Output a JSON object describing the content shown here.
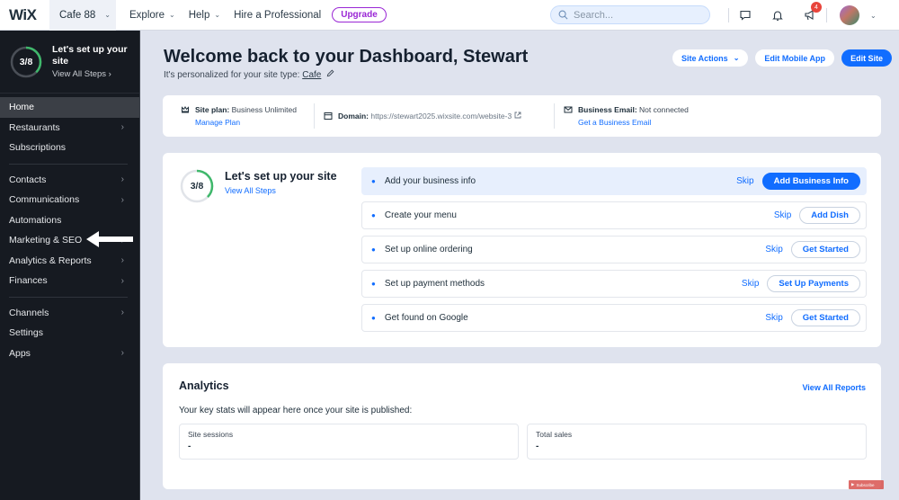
{
  "topbar": {
    "logo": "WiX",
    "site_name": "Cafe 88",
    "nav": [
      {
        "label": "Explore",
        "has_dropdown": true
      },
      {
        "label": "Help",
        "has_dropdown": true
      },
      {
        "label": "Hire a Professional",
        "has_dropdown": false
      }
    ],
    "upgrade_label": "Upgrade",
    "search_placeholder": "Search...",
    "notifications_badge": "4",
    "icons": [
      "messages-icon",
      "bell-icon",
      "announcements-icon",
      "avatar"
    ]
  },
  "sidebar": {
    "setup": {
      "progress_text": "3/8",
      "progress": 0.375,
      "title": "Let's set up your site",
      "link": "View All Steps"
    },
    "items": [
      {
        "label": "Home",
        "active": true,
        "chevron": false
      },
      {
        "label": "Restaurants",
        "chevron": true
      },
      {
        "label": "Subscriptions",
        "chevron": false
      },
      {
        "label": "Contacts",
        "chevron": true
      },
      {
        "label": "Communications",
        "chevron": true
      },
      {
        "label": "Automations",
        "chevron": false
      },
      {
        "label": "Marketing & SEO",
        "chevron": true
      },
      {
        "label": "Analytics & Reports",
        "chevron": true
      },
      {
        "label": "Finances",
        "chevron": true
      },
      {
        "label": "Channels",
        "chevron": true
      },
      {
        "label": "Settings",
        "chevron": false
      },
      {
        "label": "Apps",
        "chevron": true
      }
    ]
  },
  "header": {
    "title": "Welcome back to your Dashboard, Stewart",
    "subtitle_prefix": "It's personalized for your site type:",
    "site_type": "Cafe",
    "buttons": {
      "site_actions": "Site Actions",
      "edit_mobile": "Edit Mobile App",
      "edit_site": "Edit Site"
    }
  },
  "info": {
    "plan_label": "Site plan:",
    "plan_value": "Business Unlimited",
    "plan_link": "Manage Plan",
    "domain_label": "Domain:",
    "domain_value": "https://stewart2025.wixsite.com/website-3",
    "email_label": "Business Email:",
    "email_value": "Not connected",
    "email_link": "Get a Business Email"
  },
  "setup_card": {
    "progress_text": "3/8",
    "progress": 0.375,
    "title": "Let's set up your site",
    "link": "View All Steps",
    "steps": [
      {
        "label": "Add your business info",
        "skip": "Skip",
        "action": "Add Business Info",
        "active": true
      },
      {
        "label": "Create your menu",
        "skip": "Skip",
        "action": "Add Dish"
      },
      {
        "label": "Set up online ordering",
        "skip": "Skip",
        "action": "Get Started"
      },
      {
        "label": "Set up payment methods",
        "skip": "Skip",
        "action": "Set Up Payments"
      },
      {
        "label": "Get found on Google",
        "skip": "Skip",
        "action": "Get Started"
      }
    ]
  },
  "analytics": {
    "title": "Analytics",
    "link": "View All Reports",
    "description": "Your key stats will appear here once your site is published:",
    "stats": [
      {
        "label": "Site sessions",
        "value": "-"
      },
      {
        "label": "Total sales",
        "value": "-"
      }
    ]
  },
  "overlay": {
    "subscribe_label": "Subscribe"
  },
  "colors": {
    "accent": "#116dff",
    "upgrade": "#9a27d5",
    "progress": "#3fb86b",
    "sidebar_bg": "#161a21",
    "badge": "#e8453c"
  }
}
